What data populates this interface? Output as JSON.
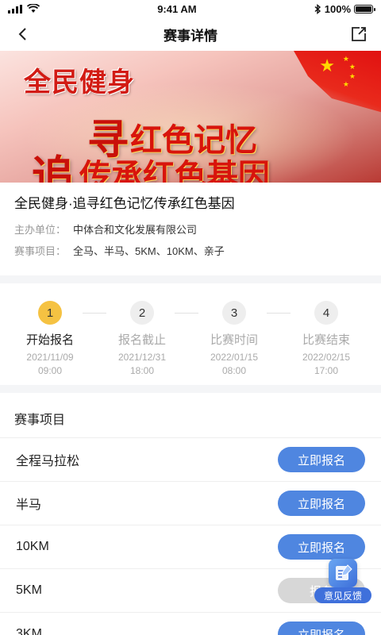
{
  "status": {
    "time": "9:41 AM",
    "battery": "100%",
    "battery_level": 1.0
  },
  "nav": {
    "title": "赛事详情",
    "back_icon": "back-arrow-icon",
    "share_icon": "share-icon"
  },
  "banner": {
    "line1": "全民健身",
    "line2_big": "寻",
    "line2": "红色记忆",
    "line3_big": "追",
    "line3": "传承红色基因"
  },
  "event": {
    "title": "全民健身·追寻红色记忆传承红色基因",
    "organizer_label": "主办单位：",
    "organizer": "中体合和文化发展有限公司",
    "items_label": "赛事项目：",
    "items": "全马、半马、5KM、10KM、亲子"
  },
  "timeline": [
    {
      "num": "1",
      "label": "开始报名",
      "date": "2021/11/09",
      "time": "09:00",
      "active": true
    },
    {
      "num": "2",
      "label": "报名截止",
      "date": "2021/12/31",
      "time": "18:00",
      "active": false
    },
    {
      "num": "3",
      "label": "比赛时间",
      "date": "2022/01/15",
      "time": "08:00",
      "active": false
    },
    {
      "num": "4",
      "label": "比赛结束",
      "date": "2022/02/15",
      "time": "17:00",
      "active": false
    }
  ],
  "section": {
    "title": "赛事项目"
  },
  "race_items": [
    {
      "name": "全程马拉松",
      "button": "立即报名",
      "enabled": true
    },
    {
      "name": "半马",
      "button": "立即报名",
      "enabled": true
    },
    {
      "name": "10KM",
      "button": "立即报名",
      "enabled": true
    },
    {
      "name": "5KM",
      "button": "报名",
      "enabled": false
    },
    {
      "name": "3KM",
      "button": "立即报名",
      "enabled": true
    }
  ],
  "feedback": {
    "label": "意见反馈"
  },
  "colors": {
    "accent": "#4f86e0",
    "step_active": "#f5c242",
    "banner_red": "#d8140c"
  }
}
